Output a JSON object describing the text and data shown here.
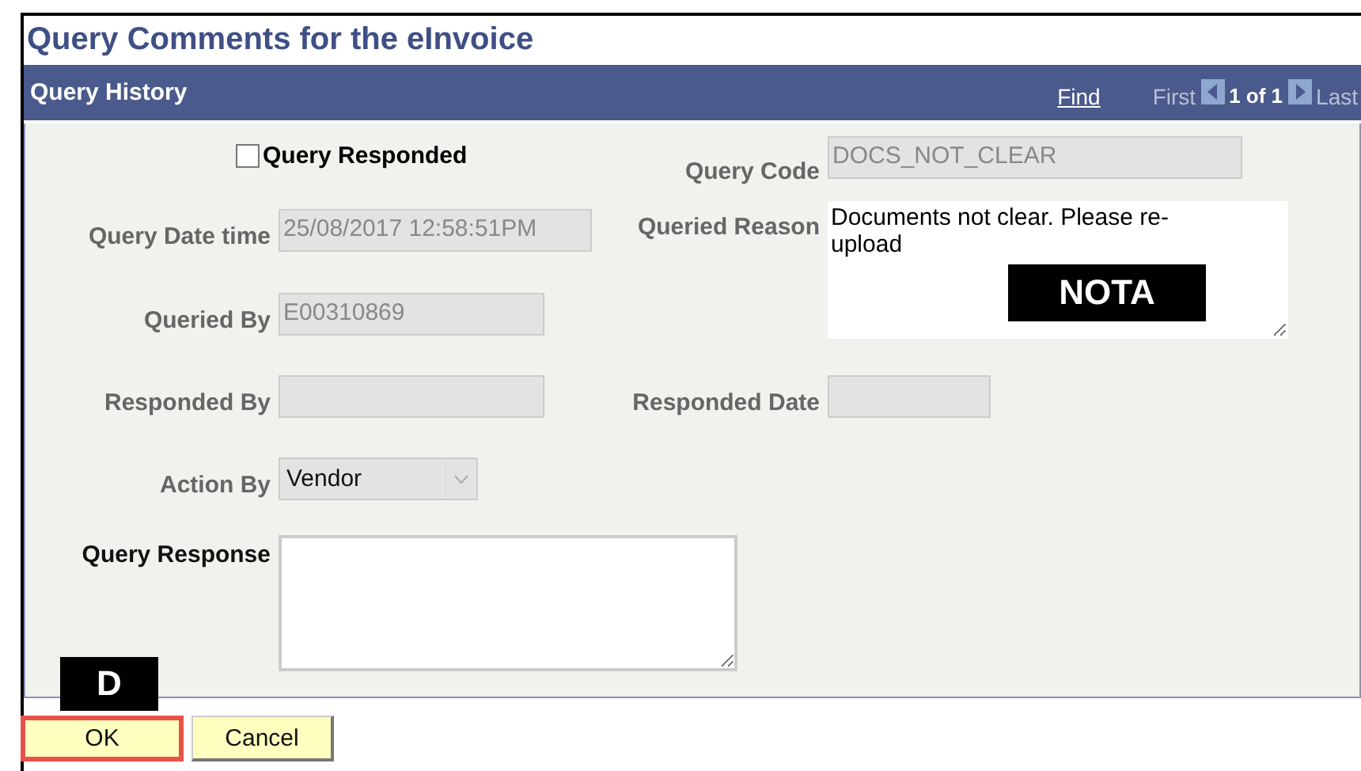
{
  "title": "Query Comments for the eInvoice",
  "section": {
    "title": "Query History",
    "find_link": "Find",
    "first": "First",
    "position": "1 of 1",
    "last": "Last"
  },
  "query_responded": {
    "label": "Query Responded",
    "checked": false
  },
  "fields": [
    {
      "label": "Query Code",
      "kind": "text",
      "value": "DOCS_NOT_CLEAR",
      "disabled": true,
      "required": false
    },
    {
      "label": "Query Date time",
      "kind": "text",
      "value": "25/08/2017 12:58:51PM",
      "disabled": true,
      "required": false
    },
    {
      "label": "Queried Reason",
      "kind": "textarea",
      "value": "Documents not clear. Please re-upload",
      "disabled": false,
      "required": false
    },
    {
      "label": "Queried By",
      "kind": "text",
      "value": "E00310869",
      "disabled": true,
      "required": false
    },
    {
      "label": "Responded By",
      "kind": "text",
      "disabled": true,
      "required": false
    },
    {
      "label": "Responded Date",
      "kind": "text",
      "disabled": true,
      "required": false
    },
    {
      "label": "Action By",
      "kind": "select",
      "value": "Vendor",
      "disabled": true,
      "required": false
    },
    {
      "label": "Query Response",
      "kind": "textarea",
      "disabled": false,
      "required": true
    }
  ],
  "annotations": [
    {
      "text": "NOTA"
    },
    {
      "text": "D"
    }
  ],
  "buttons": [
    {
      "label": "OK",
      "focused": true
    },
    {
      "label": "Cancel",
      "focused": false
    }
  ]
}
